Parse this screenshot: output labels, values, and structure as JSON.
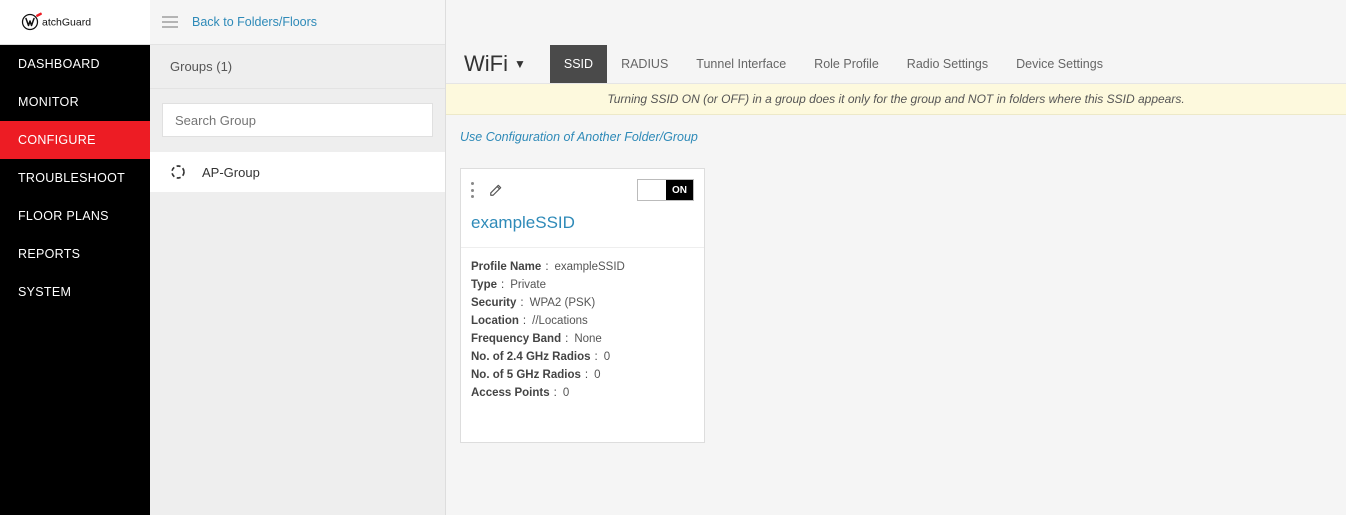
{
  "logo_text": "WatchGuard",
  "sidebar_nav": {
    "items": [
      {
        "label": "DASHBOARD",
        "active": false
      },
      {
        "label": "MONITOR",
        "active": false
      },
      {
        "label": "CONFIGURE",
        "active": true
      },
      {
        "label": "TROUBLESHOOT",
        "active": false
      },
      {
        "label": "FLOOR PLANS",
        "active": false
      },
      {
        "label": "REPORTS",
        "active": false
      },
      {
        "label": "SYSTEM",
        "active": false
      }
    ]
  },
  "breadcrumb": {
    "back_link": "Back to Folders/Floors"
  },
  "groups": {
    "header": "Groups (1)",
    "search_placeholder": "Search Group",
    "items": [
      {
        "icon": "group-icon",
        "name": "AP-Group"
      }
    ]
  },
  "main": {
    "section_title": "WiFi",
    "tabs": [
      {
        "label": "SSID",
        "active": true
      },
      {
        "label": "RADIUS",
        "active": false
      },
      {
        "label": "Tunnel Interface",
        "active": false
      },
      {
        "label": "Role Profile",
        "active": false
      },
      {
        "label": "Radio Settings",
        "active": false
      },
      {
        "label": "Device Settings",
        "active": false
      }
    ],
    "notice": "Turning SSID ON (or OFF) in a group does it only for the group and NOT in folders where this SSID appears.",
    "config_link": "Use Configuration of Another Folder/Group"
  },
  "ssid_card": {
    "toggle_on_label": "ON",
    "name": "exampleSSID",
    "props": [
      {
        "label": "Profile Name",
        "value": "exampleSSID"
      },
      {
        "label": "Type",
        "value": "Private"
      },
      {
        "label": "Security",
        "value": "WPA2 (PSK)"
      },
      {
        "label": "Location",
        "value": "//Locations"
      },
      {
        "label": "Frequency Band",
        "value": "None"
      },
      {
        "label": "No. of 2.4 GHz Radios",
        "value": "0"
      },
      {
        "label": "No. of 5 GHz Radios",
        "value": "0"
      },
      {
        "label": "Access Points",
        "value": "0"
      }
    ]
  }
}
